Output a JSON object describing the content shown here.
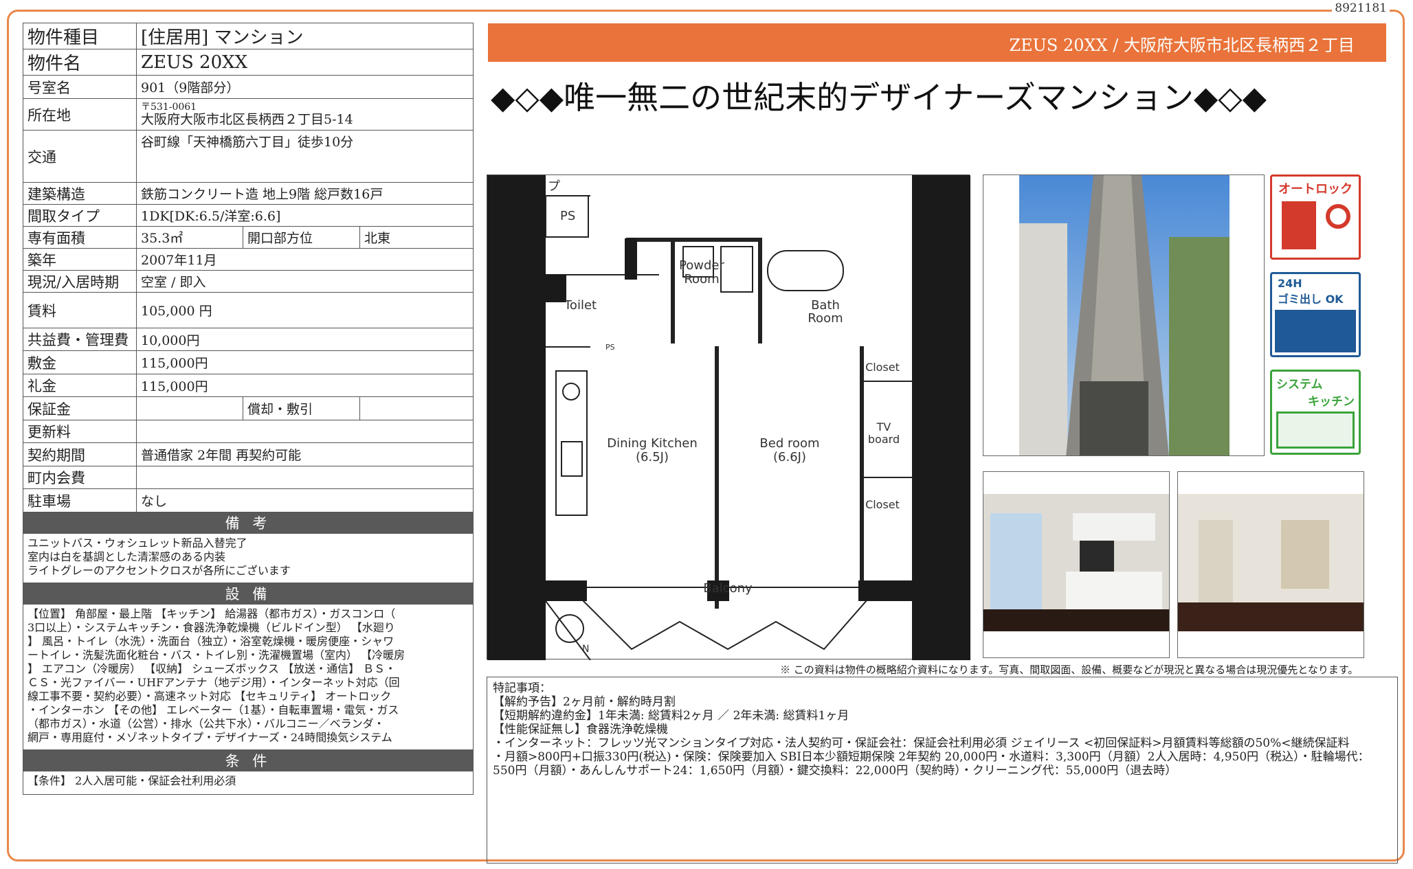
{
  "doc_id": "8921181",
  "spec": {
    "type_label": "物件種目",
    "type_value": "[住居用]  マンション",
    "name_label": "物件名",
    "name_value": "ZEUS 20XX",
    "room_label": "号室名",
    "room_value": "901（9階部分）",
    "address_label": "所在地",
    "postal": "〒531-0061",
    "address_value": "大阪府大阪市北区長柄西２丁目5-14",
    "access_label": "交通",
    "access_value": "谷町線「天神橋筋六丁目」徒歩10分",
    "structure_label": "建築構造",
    "structure_value": "鉄筋コンクリート造 地上9階 総戸数16戸",
    "layout_label": "間取タイプ",
    "layout_value": "1DK[DK:6.5/洋室:6.6]",
    "area_label": "専有面積",
    "area_value": "35.3㎡",
    "opening_label": "開口部方位",
    "opening_value": "北東",
    "built_label": "築年",
    "built_value": "2007年11月",
    "status_label": "現況/入居時期",
    "status_value": "空室  /  即入",
    "rent_label": "賃料",
    "rent_value": "105,000 円",
    "fee_label": "共益費・管理費",
    "fee_value": "10,000円",
    "deposit_label": "敷金",
    "deposit_value": "115,000円",
    "key_label": "礼金",
    "key_value": "115,000円",
    "guarantee_label": "保証金",
    "guarantee_value": "",
    "amort_label": "償却・敷引",
    "amort_value": "",
    "renewal_label": "更新料",
    "renewal_value": "",
    "contract_label": "契約期間",
    "contract_value": "普通借家 2年間 再契約可能",
    "town_label": "町内会費",
    "town_value": "",
    "parking_label": "駐車場",
    "parking_value": "なし"
  },
  "remarks": {
    "title": "備 考",
    "lines": [
      "ユニットバス・ウォシュレット新品入替完了",
      "室内は白を基調とした清潔感のある内装",
      "ライトグレーのアクセントクロスが各所にございます"
    ]
  },
  "equipment": {
    "title": "設 備",
    "lines": [
      "【位置】 角部屋・最上階 【キッチン】 給湯器（都市ガス）・ガスコンロ（",
      "3口以上）・システムキッチン・食器洗浄乾燥機（ビルドイン型） 【水廻り",
      "】 風呂・トイレ（水洗）・洗面台（独立）・浴室乾燥機・暖房便座・シャワ",
      "ートイレ・洗髪洗面化粧台・バス・トイレ別・洗濯機置場（室内） 【冷暖房",
      "】 エアコン（冷暖房） 【収納】 シューズボックス 【放送・通信】 ＢＳ・",
      "ＣＳ・光ファイバー・UHFアンテナ（地デジ用）・インターネット対応（回",
      "線工事不要・契約必要）・高速ネット対応 【セキュリティ】 オートロック",
      "・インターホン 【その他】 エレベーター（1基）・自転車置場・電気・ガス",
      "（都市ガス）・水道（公営）・排水（公共下水）・バルコニー／ベランダ・",
      "網戸・専用庭付・メゾネットタイプ・デザイナーズ・24時間換気システム"
    ]
  },
  "conditions": {
    "title": "条 件",
    "lines": [
      "【条件】 2人入居可能・保証会社利用必須"
    ]
  },
  "banner": "ZEUS 20XX /  大阪府大阪市北区長柄西２丁目",
  "catchcopy": "◆◇◆唯一無二の世紀末的デザイナーズマンション◆◇◆",
  "floorplan": {
    "ps1": "PS",
    "ps2": "PS",
    "toilet": "Toilet",
    "powder": "Powder",
    "room1": "Room",
    "bath": "Bath",
    "room2": "Room",
    "closet1": "Closet",
    "closet2": "Closet",
    "tv1": "TV",
    "tv2": "board",
    "dk1": "Dining Kitchen",
    "dk2": "(6.5J)",
    "bed1": "Bed room",
    "bed2": "(6.6J)",
    "balcony": "Balcony",
    "north": "N",
    "p": "プ"
  },
  "icons": {
    "autolock": "オートロック",
    "garbage_1": "24H",
    "garbage_2": "ゴミ出し OK",
    "kitchen_1": "システム",
    "kitchen_2": "キッチン",
    "colors": {
      "autolock": "#d33a2c",
      "garbage": "#1f5a96",
      "kitchen": "#3aa33a"
    }
  },
  "disclaimer": "※ この資料は物件の概略紹介資料になります。写真、間取図面、設備、概要などが現況と異なる場合は現況優先となります。",
  "notes": {
    "lines": [
      "特記事項：",
      "【解約予告】2ヶ月前・解約時月割",
      "【短期解約違約金】1年未満: 総賃料2ヶ月 ／ 2年未満: 総賃料1ヶ月",
      "【性能保証無し】食器洗浄乾燥機",
      "・インターネット：フレッツ光マンションタイプ対応・法人契約可・保証会社：保証会社利用必須 ジェイリース <初回保証料>月額賃料等総額の50%<継続保証料",
      "・月額>800円+口振330円(税込)・保険：保険要加入 SBI日本少額短期保険 2年契約 20,000円・水道料：3,300円（月額）2人入居時：4,950円（税込）・駐輪場代：",
      "550円（月額）・あんしんサポート24：1,650円（月額）・鍵交換料：22,000円（契約時）・クリーニング代：55,000円（退去時）"
    ]
  }
}
